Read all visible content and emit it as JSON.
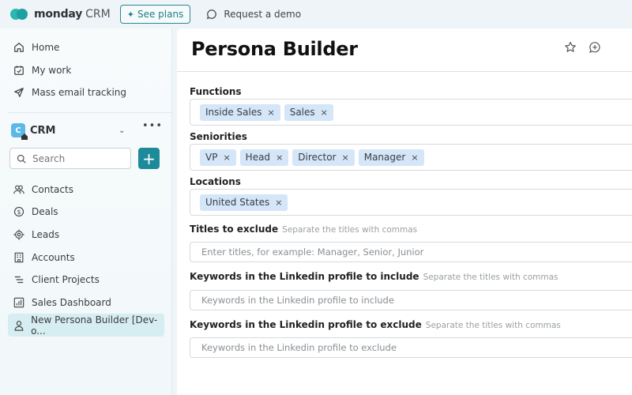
{
  "topbar": {
    "brand": "monday",
    "brand_sub": "CRM",
    "see_plans": "See plans",
    "request_demo": "Request a demo"
  },
  "sidebar": {
    "top_items": [
      {
        "label": "Home",
        "icon": "home-icon"
      },
      {
        "label": "My work",
        "icon": "calendar-check-icon"
      },
      {
        "label": "Mass email tracking",
        "icon": "send-icon"
      }
    ],
    "workspace": {
      "name": "CRM",
      "icon_letter": "C"
    },
    "search_placeholder": "Search",
    "add_label": "+",
    "items": [
      {
        "label": "Contacts",
        "icon": "contacts-icon"
      },
      {
        "label": "Deals",
        "icon": "dollar-icon"
      },
      {
        "label": "Leads",
        "icon": "target-icon"
      },
      {
        "label": "Accounts",
        "icon": "building-icon"
      },
      {
        "label": "Client Projects",
        "icon": "list-icon"
      },
      {
        "label": "Sales Dashboard",
        "icon": "chart-icon"
      },
      {
        "label": "New Persona Builder [Dev-o...",
        "icon": "person-icon",
        "active": true
      }
    ]
  },
  "main": {
    "title": "Persona Builder",
    "fields": {
      "functions": {
        "label": "Functions",
        "tags": [
          "Inside Sales",
          "Sales"
        ]
      },
      "seniorities": {
        "label": "Seniorities",
        "tags": [
          "VP",
          "Head",
          "Director",
          "Manager"
        ]
      },
      "locations": {
        "label": "Locations",
        "tags": [
          "United States"
        ]
      },
      "titles_exclude": {
        "label": "Titles to exclude",
        "hint": "Separate the titles with commas",
        "placeholder": "Enter titles, for example: Manager, Senior, Junior",
        "value": ""
      },
      "keywords_include": {
        "label": "Keywords in the Linkedin profile to include",
        "hint": "Separate the titles with commas",
        "placeholder": "Keywords in the Linkedin profile to include",
        "value": ""
      },
      "keywords_exclude": {
        "label": "Keywords in the Linkedin profile to exclude",
        "hint": "Separate the titles with commas",
        "placeholder": "Keywords in the Linkedin profile to exclude",
        "value": ""
      }
    },
    "tag_remove": "×"
  },
  "colors": {
    "accent": "#1d8a9a",
    "tag_bg": "#d4e6f8",
    "active_nav": "#d6edf1"
  }
}
